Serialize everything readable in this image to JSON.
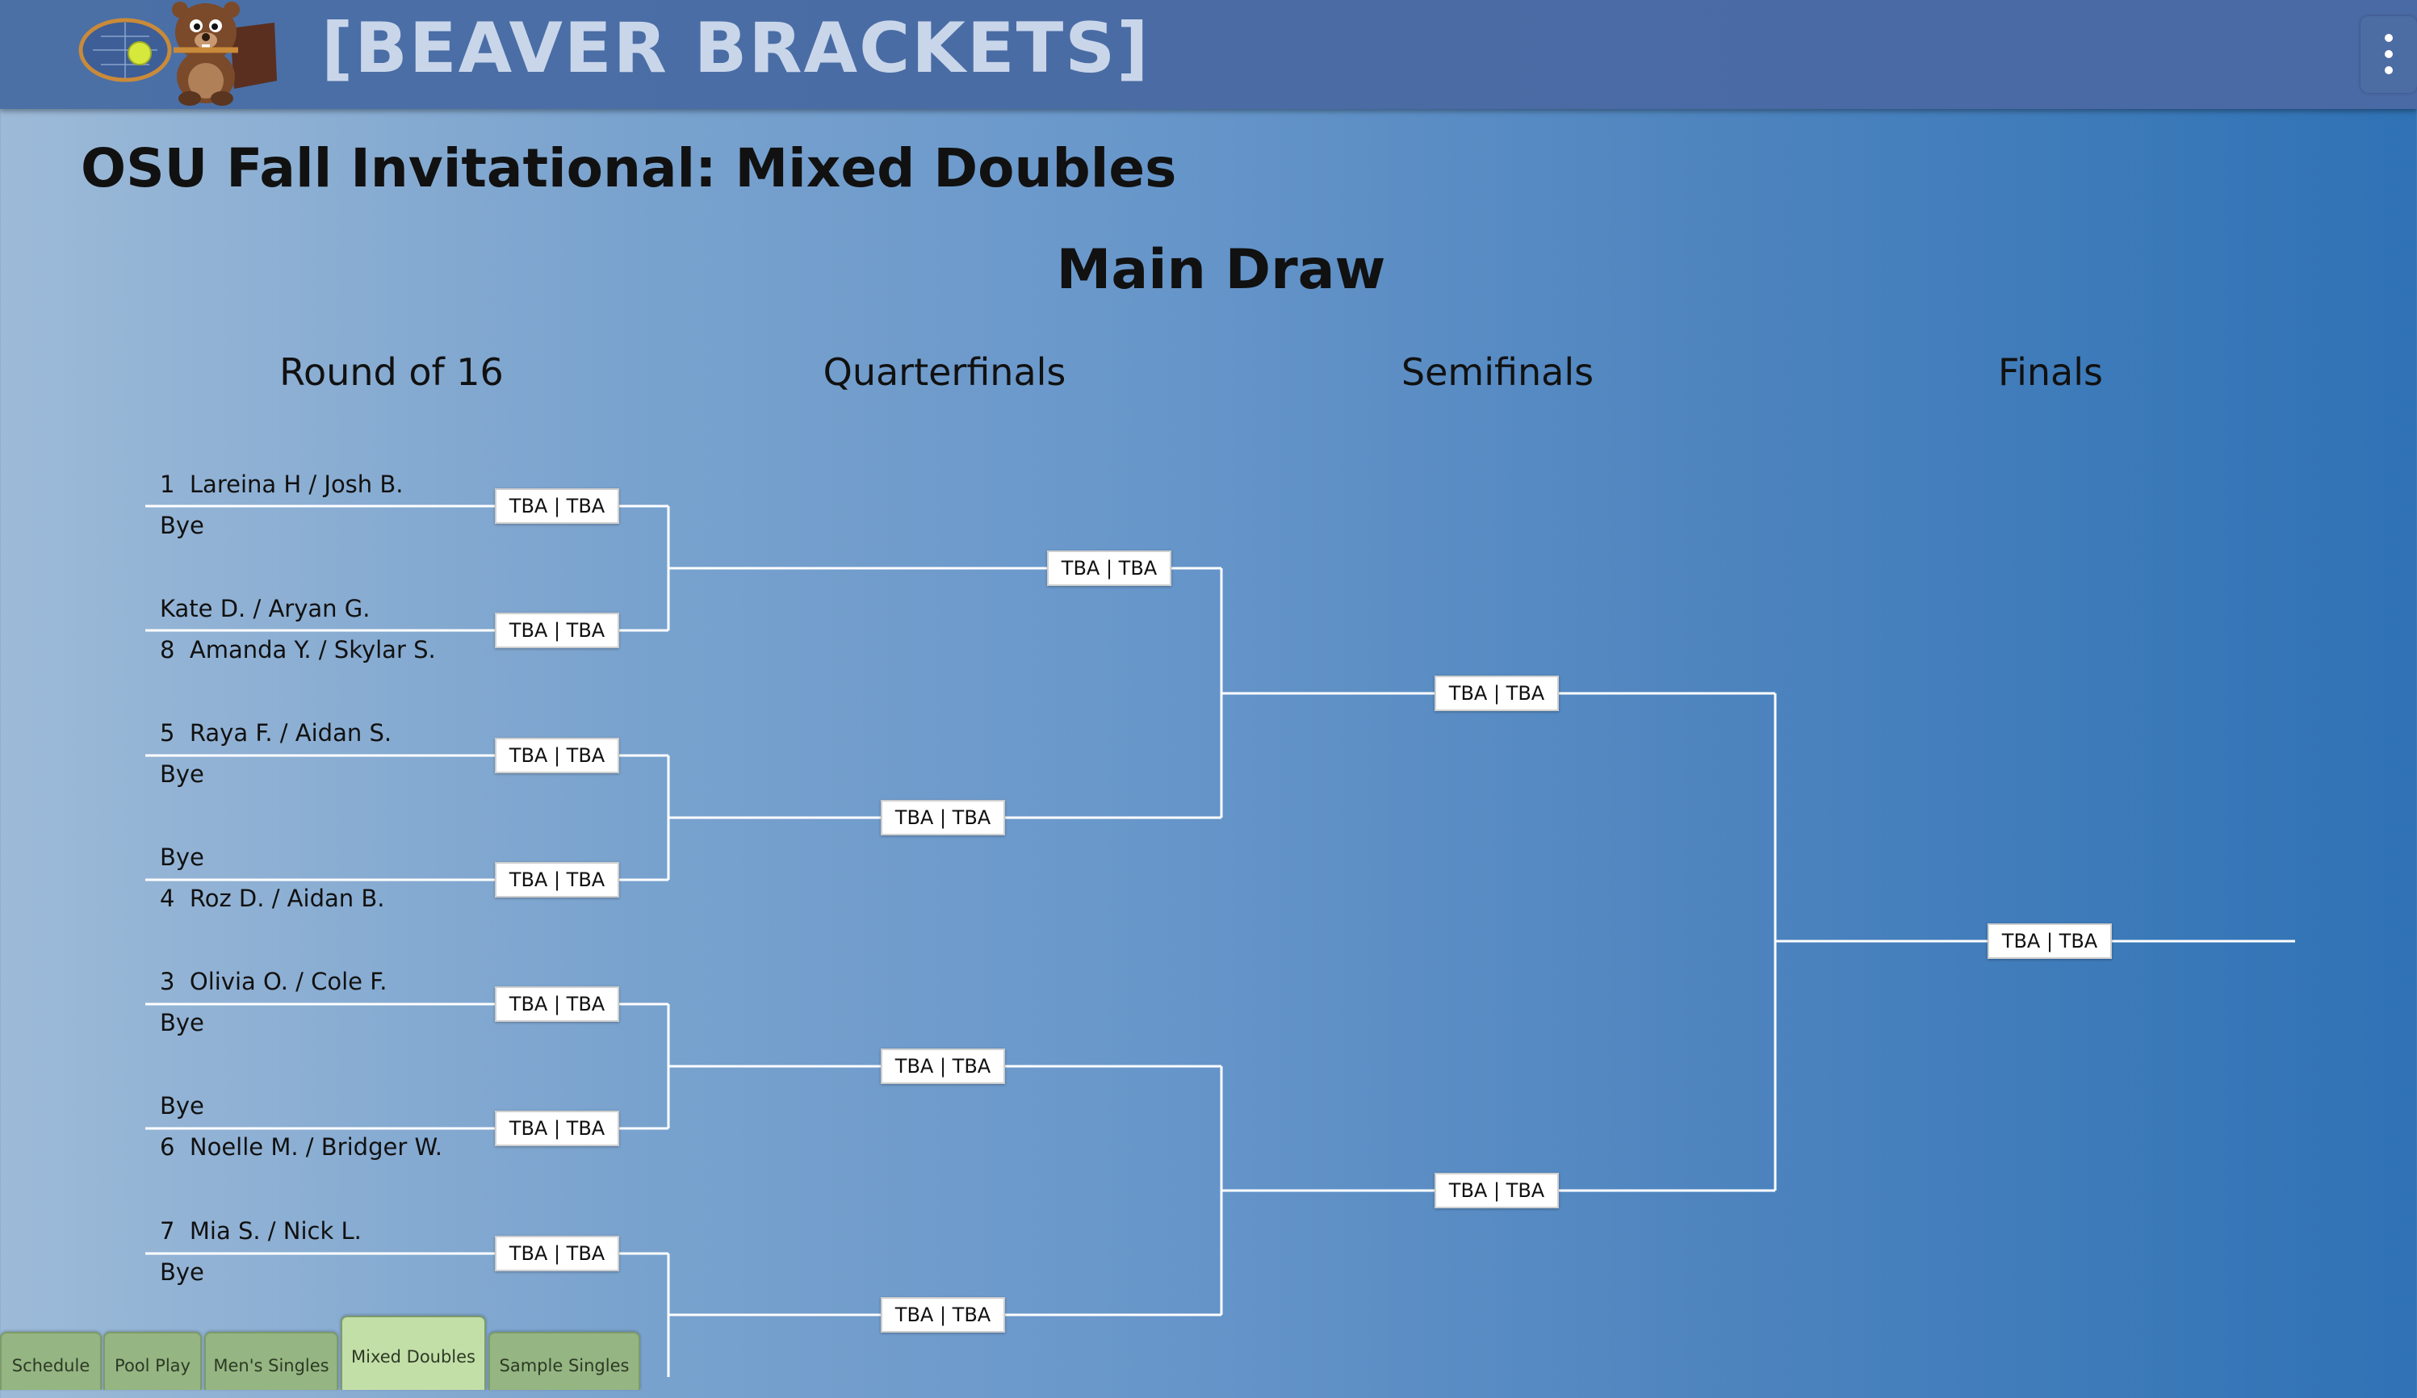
{
  "header": {
    "app_title": "[BEAVER BRACKETS]"
  },
  "page_title": "OSU Fall Invitational: Mixed Doubles",
  "draw_title": "Main Draw",
  "rounds": [
    "Round of 16",
    "Quarterfinals",
    "Semifinals",
    "Finals"
  ],
  "entries": [
    {
      "seed": "1",
      "name": "Lareina H / Josh B."
    },
    {
      "seed": "",
      "name": "Bye"
    },
    {
      "seed": "",
      "name": "Kate D. / Aryan G."
    },
    {
      "seed": "8",
      "name": "Amanda Y. / Skylar S."
    },
    {
      "seed": "5",
      "name": "Raya F. / Aidan S."
    },
    {
      "seed": "",
      "name": "Bye"
    },
    {
      "seed": "",
      "name": "Bye"
    },
    {
      "seed": "4",
      "name": "Roz D. / Aidan B."
    },
    {
      "seed": "3",
      "name": "Olivia O. / Cole F."
    },
    {
      "seed": "",
      "name": "Bye"
    },
    {
      "seed": "",
      "name": "Bye"
    },
    {
      "seed": "6",
      "name": "Noelle M. / Bridger W."
    },
    {
      "seed": "7",
      "name": "Mia S. / Nick L."
    },
    {
      "seed": "",
      "name": "Bye"
    }
  ],
  "scores": {
    "round_of_16": [
      "TBA | TBA",
      "TBA | TBA",
      "TBA | TBA",
      "TBA | TBA",
      "TBA | TBA",
      "TBA | TBA",
      "TBA | TBA"
    ],
    "quarterfinals": [
      "TBA | TBA",
      "TBA | TBA",
      "TBA | TBA",
      "TBA | TBA"
    ],
    "semifinals": [
      "TBA | TBA",
      "TBA | TBA"
    ],
    "finals": [
      "TBA | TBA"
    ]
  },
  "tabs": [
    {
      "label": "Schedule",
      "active": false
    },
    {
      "label": "Pool Play",
      "active": false
    },
    {
      "label": "Men's Singles",
      "active": false
    },
    {
      "label": "Mixed Doubles",
      "active": true
    },
    {
      "label": "Sample Singles",
      "active": false
    }
  ],
  "icons": {
    "logo": "beaver-with-tennis-racket-logo",
    "menu": "more-vertical-icon"
  },
  "colors": {
    "header_bg": "#4a6ca6",
    "tab_bg": "#95b582",
    "tab_active_bg": "#c3dfa8",
    "bracket_line": "#ffffff"
  }
}
